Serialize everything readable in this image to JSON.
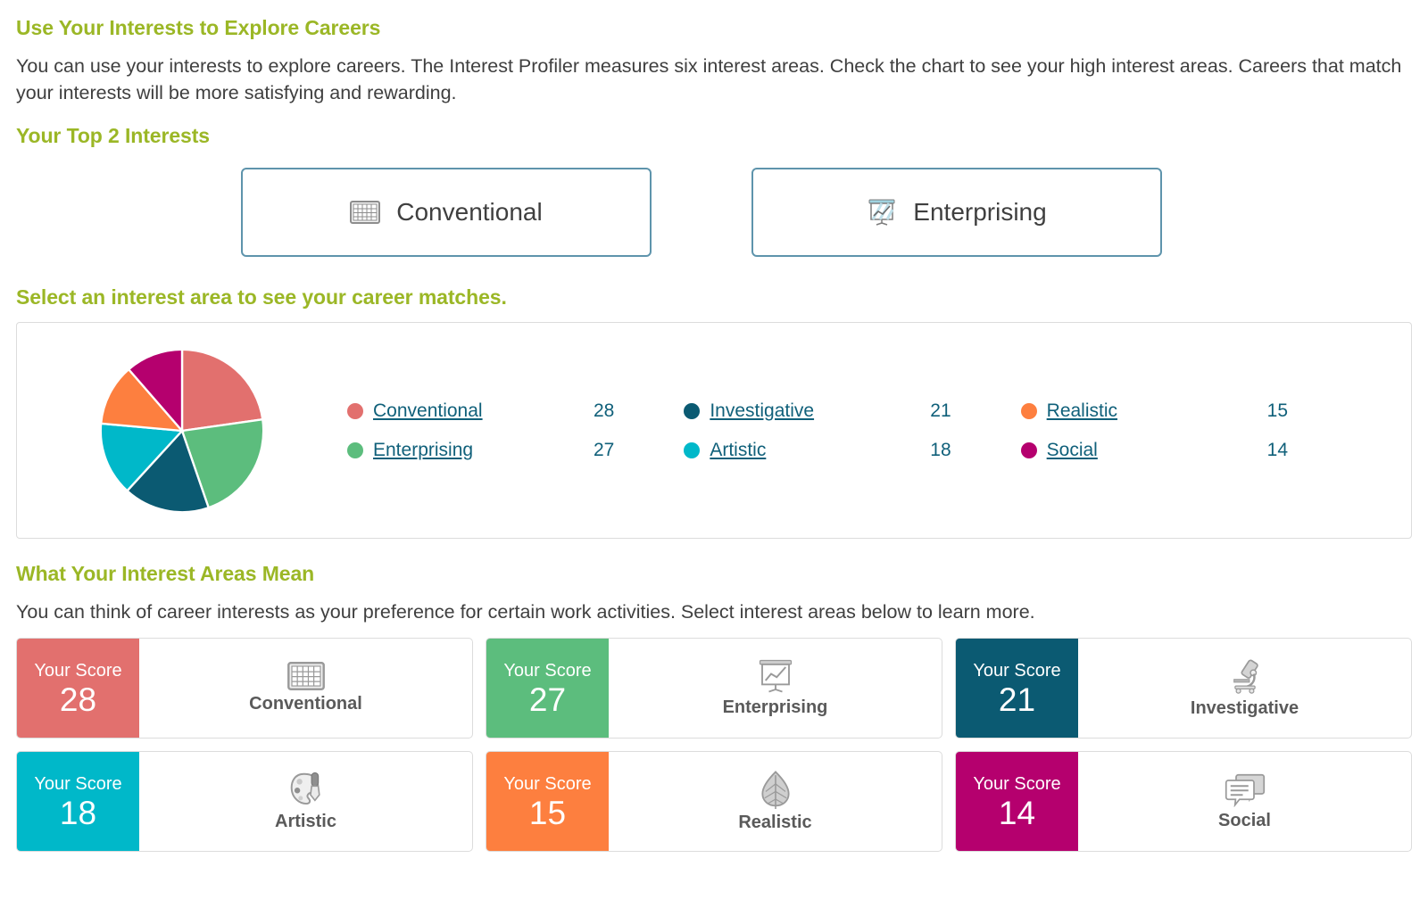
{
  "intro": {
    "heading": "Use Your Interests to Explore Careers",
    "paragraph": "You can use your interests to explore careers. The Interest Profiler measures six interest areas. Check the chart to see your high interest areas. Careers that match your interests will be more satisfying and rewarding."
  },
  "top_interests": {
    "heading": "Your Top 2 Interests",
    "cards": [
      {
        "label": "Conventional",
        "icon": "keyboard-icon"
      },
      {
        "label": "Enterprising",
        "icon": "presentation-chart-icon"
      }
    ]
  },
  "select_prompt": "Select an interest area to see your career matches.",
  "meaning": {
    "heading": "What Your Interest Areas Mean",
    "paragraph": "You can think of career interests as your preference for certain work activities. Select interest areas below to learn more."
  },
  "legend": [
    {
      "label": "Conventional",
      "value": "28",
      "color": "#e2706e"
    },
    {
      "label": "Investigative",
      "value": "21",
      "color": "#0b5a72"
    },
    {
      "label": "Realistic",
      "value": "15",
      "color": "#fd7f3f"
    },
    {
      "label": "Enterprising",
      "value": "27",
      "color": "#5cbd7d"
    },
    {
      "label": "Artistic",
      "value": "18",
      "color": "#00b8c9"
    },
    {
      "label": "Social",
      "value": "14",
      "color": "#b5006e"
    }
  ],
  "score_label": "Your Score",
  "cards": [
    {
      "name": "Conventional",
      "score": "28",
      "color": "#e2706e",
      "icon": "keyboard-icon"
    },
    {
      "name": "Enterprising",
      "score": "27",
      "color": "#5cbd7d",
      "icon": "presentation-chart-icon"
    },
    {
      "name": "Investigative",
      "score": "21",
      "color": "#0b5a72",
      "icon": "microscope-icon"
    },
    {
      "name": "Artistic",
      "score": "18",
      "color": "#00b8c9",
      "icon": "palette-icon"
    },
    {
      "name": "Realistic",
      "score": "15",
      "color": "#fd7f3f",
      "icon": "leaf-icon"
    },
    {
      "name": "Social",
      "score": "14",
      "color": "#b5006e",
      "icon": "speech-bubbles-icon"
    }
  ],
  "chart_data": {
    "type": "pie",
    "title": "",
    "categories": [
      "Conventional",
      "Enterprising",
      "Investigative",
      "Artistic",
      "Realistic",
      "Social"
    ],
    "values": [
      28,
      27,
      21,
      18,
      15,
      14
    ],
    "colors": [
      "#e2706e",
      "#5cbd7d",
      "#0b5a72",
      "#00b8c9",
      "#fd7f3f",
      "#b5006e"
    ],
    "total": 123,
    "start_angle": 0,
    "direction": "clockwise",
    "legend": "right",
    "grid": false
  }
}
